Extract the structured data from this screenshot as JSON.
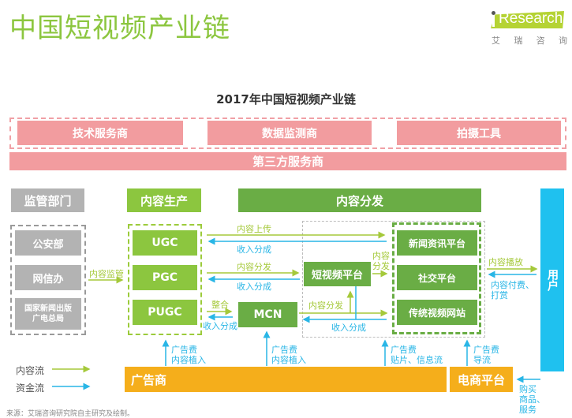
{
  "header": {
    "title": "中国短视频产业链",
    "logo": {
      "brand": "Research",
      "brand_prefix": "i",
      "sub": [
        "艾",
        "瑞",
        "咨",
        "询"
      ]
    }
  },
  "diagram": {
    "title": "2017年中国短视频产业链",
    "third_party": {
      "items": [
        "技术服务商",
        "数据监测商",
        "拍摄工具"
      ],
      "label": "第三方服务商"
    },
    "regulators": {
      "heading": "监管部门",
      "items": [
        "公安部",
        "网信办",
        "国家新闻出版\n广电总局"
      ],
      "items_lines": [
        [
          "公安部"
        ],
        [
          "网信办"
        ],
        [
          "国家新闻出版",
          "广电总局"
        ]
      ]
    },
    "production": {
      "heading": "内容生产",
      "items": [
        "UGC",
        "PGC",
        "PUGC"
      ]
    },
    "distribution": {
      "heading": "内容分发",
      "short_video_platform": "短视频平台",
      "mcn": "MCN",
      "platforms": [
        "新闻资讯平台",
        "社交平台",
        "传统视频网站"
      ]
    },
    "user": "用户",
    "advertiser": "广告商",
    "ecommerce": "电商平台",
    "flows": {
      "content_supervision": "内容监管",
      "content_upload": "内容上传",
      "revenue_share_1": "收入分成",
      "content_distribute_1": "内容分发",
      "revenue_share_2": "收入分成",
      "integrate": "整合",
      "revenue_share_3": "收入分成",
      "content_distribute_2_l1": "内容",
      "content_distribute_2_l2": "分发",
      "content_distribute_3": "内容分发",
      "revenue_share_4": "收入分成",
      "content_play": "内容播放",
      "content_pay_l1": "内容付费、",
      "content_pay_l2": "打赏",
      "ad_fee_1_l1": "广告费",
      "ad_fee_1_l2": "内容植入",
      "ad_fee_2_l1": "广告费",
      "ad_fee_2_l2": "内容植入",
      "ad_fee_3_l1": "广告费",
      "ad_fee_3_l2": "贴片、信息流",
      "ad_fee_4_l1": "广告费",
      "ad_fee_4_l2": "导流",
      "purchase_l1": "购买",
      "purchase_l2": "商品、",
      "purchase_l3": "服务"
    },
    "legend": [
      {
        "label": "内容流",
        "color": "#a5c93a"
      },
      {
        "label": "资金流",
        "color": "#29b6e6"
      }
    ]
  },
  "source": "来源：艾瑞咨询研究院自主研究及绘制。",
  "colors": {
    "title_green": "#8cc63f",
    "pink": "#f29c9f",
    "gray": "#b3b3b3",
    "light_green": "#8cc63f",
    "dark_green": "#6aad45",
    "orange": "#f5ae1b",
    "blue": "#1fc1ef",
    "content_flow": "#a5c93a",
    "money_flow": "#29b6e6"
  }
}
